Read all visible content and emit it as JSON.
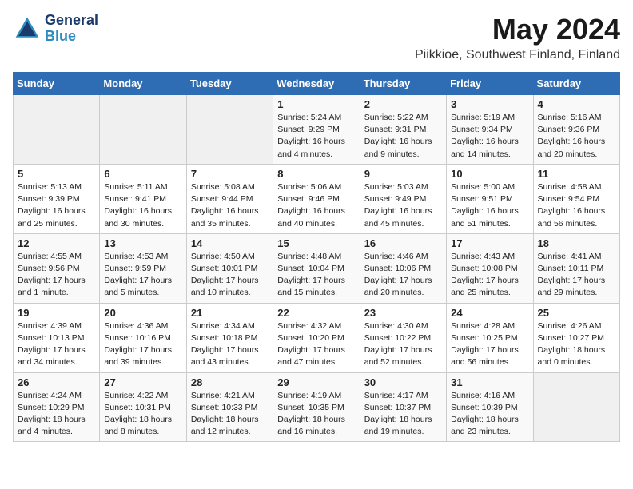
{
  "logo": {
    "line1": "General",
    "line2": "Blue"
  },
  "title": "May 2024",
  "location": "Piikkioe, Southwest Finland, Finland",
  "weekdays": [
    "Sunday",
    "Monday",
    "Tuesday",
    "Wednesday",
    "Thursday",
    "Friday",
    "Saturday"
  ],
  "weeks": [
    [
      {
        "day": "",
        "info": ""
      },
      {
        "day": "",
        "info": ""
      },
      {
        "day": "",
        "info": ""
      },
      {
        "day": "1",
        "info": "Sunrise: 5:24 AM\nSunset: 9:29 PM\nDaylight: 16 hours\nand 4 minutes."
      },
      {
        "day": "2",
        "info": "Sunrise: 5:22 AM\nSunset: 9:31 PM\nDaylight: 16 hours\nand 9 minutes."
      },
      {
        "day": "3",
        "info": "Sunrise: 5:19 AM\nSunset: 9:34 PM\nDaylight: 16 hours\nand 14 minutes."
      },
      {
        "day": "4",
        "info": "Sunrise: 5:16 AM\nSunset: 9:36 PM\nDaylight: 16 hours\nand 20 minutes."
      }
    ],
    [
      {
        "day": "5",
        "info": "Sunrise: 5:13 AM\nSunset: 9:39 PM\nDaylight: 16 hours\nand 25 minutes."
      },
      {
        "day": "6",
        "info": "Sunrise: 5:11 AM\nSunset: 9:41 PM\nDaylight: 16 hours\nand 30 minutes."
      },
      {
        "day": "7",
        "info": "Sunrise: 5:08 AM\nSunset: 9:44 PM\nDaylight: 16 hours\nand 35 minutes."
      },
      {
        "day": "8",
        "info": "Sunrise: 5:06 AM\nSunset: 9:46 PM\nDaylight: 16 hours\nand 40 minutes."
      },
      {
        "day": "9",
        "info": "Sunrise: 5:03 AM\nSunset: 9:49 PM\nDaylight: 16 hours\nand 45 minutes."
      },
      {
        "day": "10",
        "info": "Sunrise: 5:00 AM\nSunset: 9:51 PM\nDaylight: 16 hours\nand 51 minutes."
      },
      {
        "day": "11",
        "info": "Sunrise: 4:58 AM\nSunset: 9:54 PM\nDaylight: 16 hours\nand 56 minutes."
      }
    ],
    [
      {
        "day": "12",
        "info": "Sunrise: 4:55 AM\nSunset: 9:56 PM\nDaylight: 17 hours\nand 1 minute."
      },
      {
        "day": "13",
        "info": "Sunrise: 4:53 AM\nSunset: 9:59 PM\nDaylight: 17 hours\nand 5 minutes."
      },
      {
        "day": "14",
        "info": "Sunrise: 4:50 AM\nSunset: 10:01 PM\nDaylight: 17 hours\nand 10 minutes."
      },
      {
        "day": "15",
        "info": "Sunrise: 4:48 AM\nSunset: 10:04 PM\nDaylight: 17 hours\nand 15 minutes."
      },
      {
        "day": "16",
        "info": "Sunrise: 4:46 AM\nSunset: 10:06 PM\nDaylight: 17 hours\nand 20 minutes."
      },
      {
        "day": "17",
        "info": "Sunrise: 4:43 AM\nSunset: 10:08 PM\nDaylight: 17 hours\nand 25 minutes."
      },
      {
        "day": "18",
        "info": "Sunrise: 4:41 AM\nSunset: 10:11 PM\nDaylight: 17 hours\nand 29 minutes."
      }
    ],
    [
      {
        "day": "19",
        "info": "Sunrise: 4:39 AM\nSunset: 10:13 PM\nDaylight: 17 hours\nand 34 minutes."
      },
      {
        "day": "20",
        "info": "Sunrise: 4:36 AM\nSunset: 10:16 PM\nDaylight: 17 hours\nand 39 minutes."
      },
      {
        "day": "21",
        "info": "Sunrise: 4:34 AM\nSunset: 10:18 PM\nDaylight: 17 hours\nand 43 minutes."
      },
      {
        "day": "22",
        "info": "Sunrise: 4:32 AM\nSunset: 10:20 PM\nDaylight: 17 hours\nand 47 minutes."
      },
      {
        "day": "23",
        "info": "Sunrise: 4:30 AM\nSunset: 10:22 PM\nDaylight: 17 hours\nand 52 minutes."
      },
      {
        "day": "24",
        "info": "Sunrise: 4:28 AM\nSunset: 10:25 PM\nDaylight: 17 hours\nand 56 minutes."
      },
      {
        "day": "25",
        "info": "Sunrise: 4:26 AM\nSunset: 10:27 PM\nDaylight: 18 hours\nand 0 minutes."
      }
    ],
    [
      {
        "day": "26",
        "info": "Sunrise: 4:24 AM\nSunset: 10:29 PM\nDaylight: 18 hours\nand 4 minutes."
      },
      {
        "day": "27",
        "info": "Sunrise: 4:22 AM\nSunset: 10:31 PM\nDaylight: 18 hours\nand 8 minutes."
      },
      {
        "day": "28",
        "info": "Sunrise: 4:21 AM\nSunset: 10:33 PM\nDaylight: 18 hours\nand 12 minutes."
      },
      {
        "day": "29",
        "info": "Sunrise: 4:19 AM\nSunset: 10:35 PM\nDaylight: 18 hours\nand 16 minutes."
      },
      {
        "day": "30",
        "info": "Sunrise: 4:17 AM\nSunset: 10:37 PM\nDaylight: 18 hours\nand 19 minutes."
      },
      {
        "day": "31",
        "info": "Sunrise: 4:16 AM\nSunset: 10:39 PM\nDaylight: 18 hours\nand 23 minutes."
      },
      {
        "day": "",
        "info": ""
      }
    ]
  ]
}
